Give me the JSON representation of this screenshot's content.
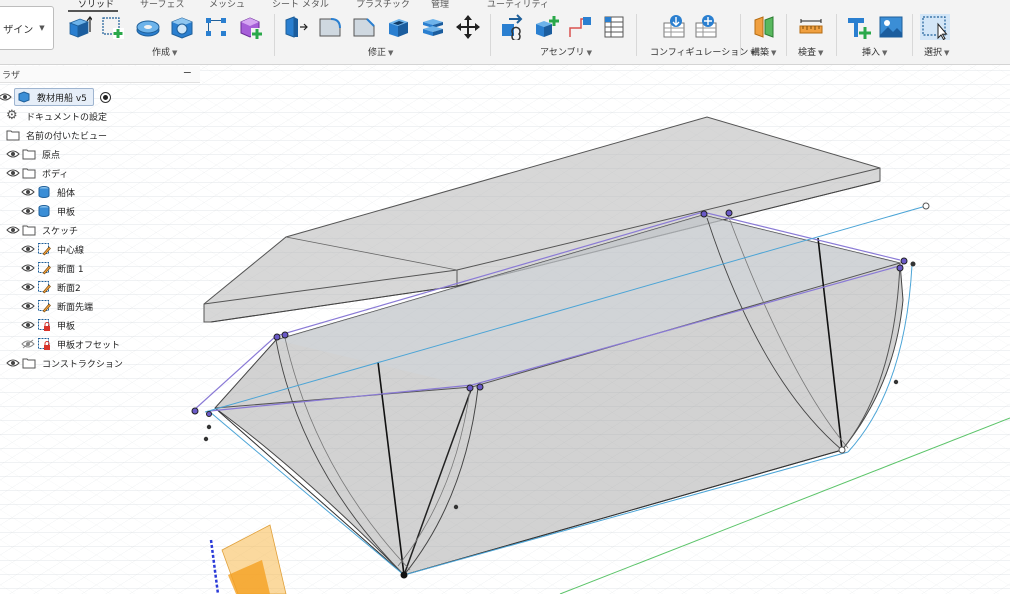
{
  "toolbar": {
    "workspace": "ザイン",
    "tabs": [
      "ソリッド",
      "サーフェス",
      "メッシュ",
      "シート メタル",
      "プラスチック",
      "管理",
      "ユーティリティ"
    ],
    "groups": {
      "create": "作成",
      "modify": "修正",
      "assemble": "アセンブリ",
      "configure": "コンフィギュレーション",
      "construct": "構築",
      "inspect": "検査",
      "insert": "挿入",
      "select": "選択"
    }
  },
  "browser": {
    "title": "ラザ",
    "collapse": "−",
    "root": "教材用船 v5",
    "items": [
      "ドキュメントの設定",
      "名前の付いたビュー",
      "原点",
      "ボディ",
      "船体",
      "甲板",
      "スケッチ",
      "中心線",
      "断面 1",
      "断面2",
      "断面先端",
      "甲板",
      "甲板オフセット",
      "コンストラクション"
    ]
  }
}
